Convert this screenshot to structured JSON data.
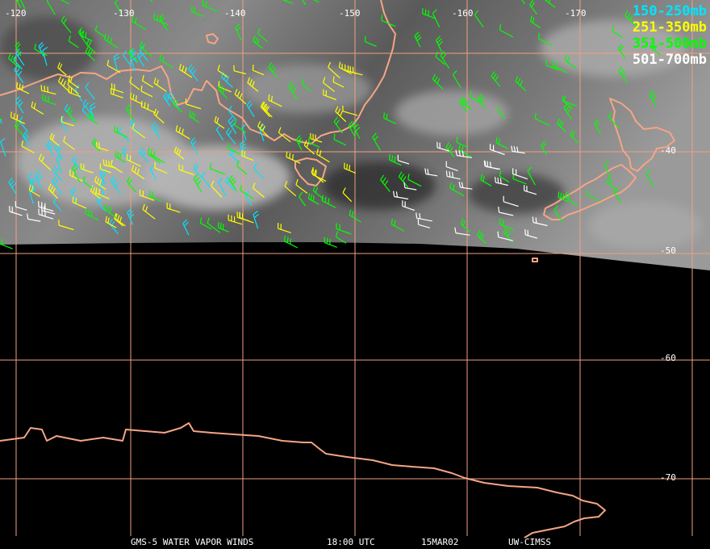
{
  "map": {
    "satellite_product": "GMS-5 WATER VAPOR WINDS",
    "time": "18:00 UTC",
    "date": "15MAR02",
    "source": "UW-CIMSS",
    "longitude_labels": [
      "-120",
      "-130",
      "-140",
      "-150",
      "-160",
      "-170"
    ],
    "latitude_labels": [
      "-40",
      "-50",
      "-60",
      "-70"
    ],
    "colors": {
      "grid": "#f0a080",
      "coastline": "#f5a585",
      "level_150_250": "#00e5ff",
      "level_251_350": "#ffff00",
      "level_351_500": "#00ff00",
      "level_501_700": "#ffffff"
    }
  },
  "legend": [
    {
      "label": "150-250mb",
      "color": "#00e5ff"
    },
    {
      "label": "251-350mb",
      "color": "#ffff00"
    },
    {
      "label": "351-500mb",
      "color": "#00ff00"
    },
    {
      "label": "501-700mb",
      "color": "#ffffff"
    }
  ]
}
